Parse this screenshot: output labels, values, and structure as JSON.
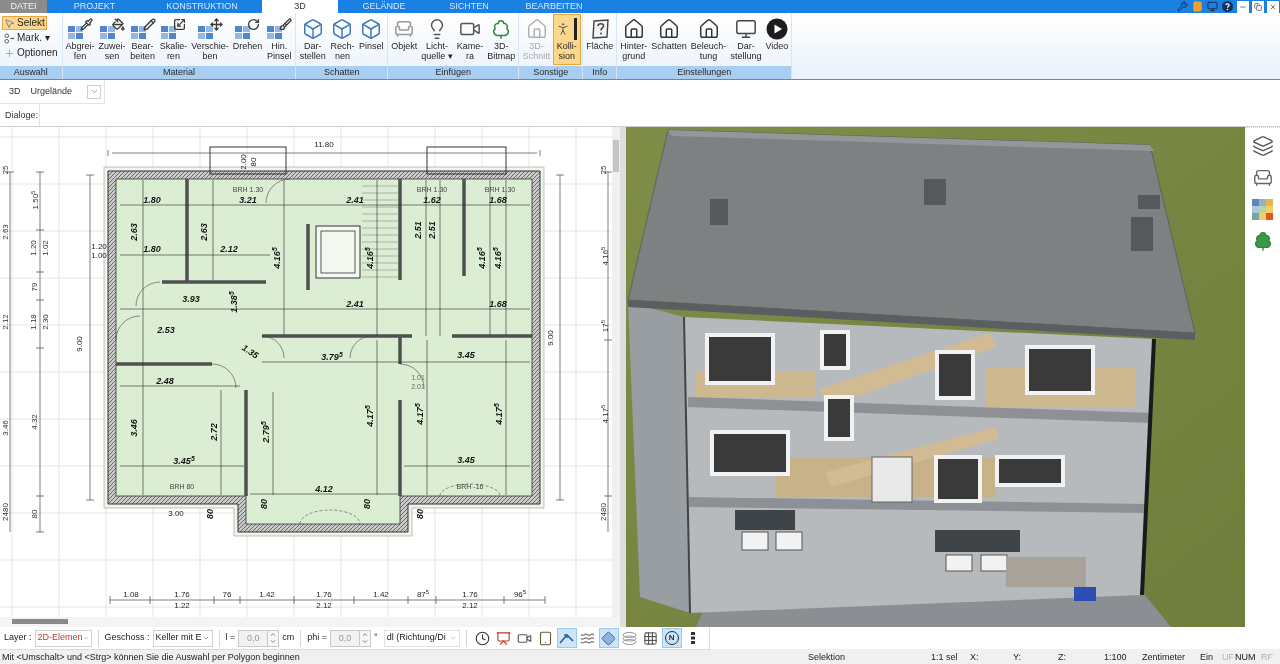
{
  "menu_tabs": [
    {
      "label": "DATEI",
      "kind": "file",
      "selected": false
    },
    {
      "label": "PROJEKT",
      "kind": "tab",
      "selected": false
    },
    {
      "label": "KONSTRUKTION",
      "kind": "tab",
      "selected": false
    },
    {
      "label": "3D",
      "kind": "tab",
      "selected": true
    },
    {
      "label": "GELÄNDE",
      "kind": "tab",
      "selected": false
    },
    {
      "label": "SICHTEN",
      "kind": "tab",
      "selected": false
    },
    {
      "label": "BEARBEITEN",
      "kind": "tab",
      "selected": false
    }
  ],
  "ribbon": {
    "groups": [
      {
        "title": "Auswahl",
        "buttons": [
          {
            "label": "Selekt",
            "kind": "small",
            "selected": true
          },
          {
            "label": "Mark. ▾",
            "kind": "small",
            "selected": false
          },
          {
            "label": "Optionen",
            "kind": "small",
            "selected": false
          }
        ]
      },
      {
        "title": "Material",
        "buttons": [
          {
            "label": "Abgrei-\nfen",
            "kind": "large",
            "selected": false
          },
          {
            "label": "Zuwei-\nsen",
            "kind": "large",
            "selected": false
          },
          {
            "label": "Bear-\nbeiten",
            "kind": "large",
            "selected": false
          },
          {
            "label": "Skalie-\nren",
            "kind": "large",
            "selected": false
          },
          {
            "label": "Verschie-\nben",
            "kind": "large",
            "selected": false
          },
          {
            "label": "Drehen",
            "kind": "large",
            "selected": false
          },
          {
            "label": "Hin.\nPinsel",
            "kind": "large",
            "selected": false
          }
        ]
      },
      {
        "title": "Schatten",
        "buttons": [
          {
            "label": "Dar-\nstellen",
            "kind": "large",
            "selected": false
          },
          {
            "label": "Rech-\nnen",
            "kind": "large",
            "selected": false
          },
          {
            "label": "Pinsel",
            "kind": "large",
            "selected": false
          }
        ]
      },
      {
        "title": "Einfügen",
        "buttons": [
          {
            "label": "Objekt",
            "kind": "large",
            "selected": false
          },
          {
            "label": "Licht-\nquelle ▾",
            "kind": "large",
            "selected": false
          },
          {
            "label": "Kame-\nra",
            "kind": "large",
            "selected": false
          },
          {
            "label": "3D-\nBitmap",
            "kind": "large",
            "selected": false
          }
        ]
      },
      {
        "title": "Sonstige",
        "buttons": [
          {
            "label": "3D-\nSchnitt",
            "kind": "large",
            "selected": false,
            "disabled": true
          },
          {
            "label": "Kolli-\nsion",
            "kind": "large",
            "selected": true,
            "disabled": false
          }
        ]
      },
      {
        "title": "Info",
        "buttons": [
          {
            "label": "Fläche",
            "kind": "large",
            "selected": false
          }
        ]
      },
      {
        "title": "Einstellungen",
        "buttons": [
          {
            "label": "Hinter-\ngrund",
            "kind": "large",
            "selected": false
          },
          {
            "label": "Schatten",
            "kind": "large",
            "selected": false
          },
          {
            "label": "Beleuch-\ntung",
            "kind": "large",
            "selected": false
          },
          {
            "label": "Dar-\nstellung",
            "kind": "large",
            "selected": false
          },
          {
            "label": "Video",
            "kind": "large",
            "selected": false
          }
        ]
      }
    ]
  },
  "view_selector": {
    "label": "3D",
    "value": "Urgelände"
  },
  "dialogs": {
    "label": "Dialoge:"
  },
  "floor_plan": {
    "labels": [
      {
        "text": "11.80",
        "kind": "outer"
      },
      {
        "text": "9.00",
        "kind": "outer"
      },
      {
        "text": "9.00",
        "kind": "outer"
      },
      {
        "text": "25",
        "kind": "ruler"
      },
      {
        "text": "1.50$^{5}$",
        "kind": "ruler"
      },
      {
        "text": "2.63",
        "kind": "ruler"
      },
      {
        "text": "1.20",
        "kind": "ruler"
      },
      {
        "text": "1.02",
        "kind": "ruler"
      },
      {
        "text": "79",
        "kind": "ruler"
      },
      {
        "text": "2.12",
        "kind": "ruler"
      },
      {
        "text": "1.18",
        "kind": "ruler"
      },
      {
        "text": "2.30",
        "kind": "ruler"
      },
      {
        "text": "3.46",
        "kind": "ruler"
      },
      {
        "text": "4.32",
        "kind": "ruler"
      },
      {
        "text": "80",
        "kind": "ruler"
      },
      {
        "text": "2480",
        "kind": "ruler"
      },
      {
        "text": "25",
        "kind": "ruler"
      },
      {
        "text": "4.16$^{5}$",
        "kind": "ruler"
      },
      {
        "text": "17$^{5}$",
        "kind": "ruler"
      },
      {
        "text": "4.17$^{5}$",
        "kind": "ruler"
      },
      {
        "text": "2480",
        "kind": "ruler"
      },
      {
        "text": "1.80",
        "kind": "room"
      },
      {
        "text": "3.21",
        "kind": "room"
      },
      {
        "text": "2.41",
        "kind": "room"
      },
      {
        "text": "1.62",
        "kind": "room"
      },
      {
        "text": "1.68",
        "kind": "room"
      },
      {
        "text": "1.80",
        "kind": "room"
      },
      {
        "text": "2.12",
        "kind": "room"
      },
      {
        "text": "3.93",
        "kind": "room"
      },
      {
        "text": "2.41",
        "kind": "room"
      },
      {
        "text": "1.68",
        "kind": "room"
      },
      {
        "text": "2.53",
        "kind": "room"
      },
      {
        "text": "3.79$^{5}$",
        "kind": "room"
      },
      {
        "text": "3.45",
        "kind": "room"
      },
      {
        "text": "2.48",
        "kind": "room"
      },
      {
        "text": "3.45$^{5}$",
        "kind": "room"
      },
      {
        "text": "3.45",
        "kind": "room"
      },
      {
        "text": "4.12",
        "kind": "room"
      },
      {
        "text": "2.63",
        "kind": "room"
      },
      {
        "text": "2.63",
        "kind": "room"
      },
      {
        "text": "4.16$^{5}$",
        "kind": "room"
      },
      {
        "text": "4.16$^{5}$",
        "kind": "room"
      },
      {
        "text": "2.51",
        "kind": "room"
      },
      {
        "text": "2.51",
        "kind": "room"
      },
      {
        "text": "4.16$^{5}$",
        "kind": "room"
      },
      {
        "text": "4.16$^{5}$",
        "kind": "room"
      },
      {
        "text": "1.38$^{5}$",
        "kind": "room"
      },
      {
        "text": "3.46",
        "kind": "room"
      },
      {
        "text": "2.72",
        "kind": "room"
      },
      {
        "text": "2.79$^{5}$",
        "kind": "room"
      },
      {
        "text": "4.17$^{5}$",
        "kind": "room"
      },
      {
        "text": "4.17$^{5}$",
        "kind": "room"
      },
      {
        "text": "4.17$^{5}$",
        "kind": "room"
      },
      {
        "text": "80",
        "kind": "room"
      },
      {
        "text": "80",
        "kind": "room"
      },
      {
        "text": "80",
        "kind": "room"
      },
      {
        "text": "80",
        "kind": "room"
      },
      {
        "text": "1.35",
        "kind": "room"
      },
      {
        "text": "3.00",
        "kind": "outer"
      },
      {
        "text": "1.08",
        "kind": "outer"
      },
      {
        "text": "1.76",
        "kind": "outer"
      },
      {
        "text": "76",
        "kind": "outer"
      },
      {
        "text": "1.42",
        "kind": "outer"
      },
      {
        "text": "1.76",
        "kind": "outer"
      },
      {
        "text": "1.42",
        "kind": "outer"
      },
      {
        "text": "87$^{5}$",
        "kind": "outer"
      },
      {
        "text": "1.76",
        "kind": "outer"
      },
      {
        "text": "96$^{5}$",
        "kind": "outer"
      },
      {
        "text": "1.22",
        "kind": "outer"
      },
      {
        "text": "2.12",
        "kind": "outer"
      },
      {
        "text": "2.12",
        "kind": "outer"
      },
      {
        "text": "BRH 1.30",
        "kind": "note"
      },
      {
        "text": "BRH 1.30",
        "kind": "note"
      },
      {
        "text": "BRH 1.30",
        "kind": "note"
      },
      {
        "text": "BRH 80",
        "kind": "note"
      },
      {
        "text": "BRH -16",
        "kind": "note"
      },
      {
        "text": "1.01",
        "kind": "door"
      },
      {
        "text": "2.01",
        "kind": "door"
      },
      {
        "text": "1.20",
        "kind": "outer"
      },
      {
        "text": "1.00",
        "kind": "outer"
      },
      {
        "text": "2.00",
        "kind": "outer"
      },
      {
        "text": "80",
        "kind": "outer"
      }
    ]
  },
  "bottom_toolbar": {
    "layer_label": "Layer :",
    "layer_value": "2D-Elemen",
    "floor_label": "Geschoss :",
    "floor_value": "Keller mit E",
    "length_label": "l =",
    "length_value": "0,0",
    "length_disabled": true,
    "length_unit": "cm",
    "angle_label": "phi =",
    "angle_value": "0,0",
    "angle_disabled": true,
    "angle_unit": "°",
    "direction_value": "dl (Richtung/Di",
    "tools": [
      {
        "selected": false
      },
      {
        "selected": false
      },
      {
        "selected": false
      },
      {
        "selected": false
      },
      {
        "selected": true
      },
      {
        "selected": false
      },
      {
        "selected": true
      },
      {
        "selected": false
      },
      {
        "selected": false
      },
      {
        "label": "N",
        "selected": true
      },
      {
        "selected": false
      }
    ]
  },
  "status_bar": {
    "message": "Mit <Umschalt> und <Strg> können Sie die Auswahl per Polygon beginnen",
    "panes": [
      "Selektion",
      "1:1 sel",
      "X:",
      "Y:",
      "Z:",
      "1:100",
      "Zentimeter",
      "Ein"
    ],
    "indicators": [
      {
        "label": "UF",
        "on": false
      },
      {
        "label": "NUM",
        "on": true
      },
      {
        "label": "RF",
        "on": false
      }
    ]
  }
}
